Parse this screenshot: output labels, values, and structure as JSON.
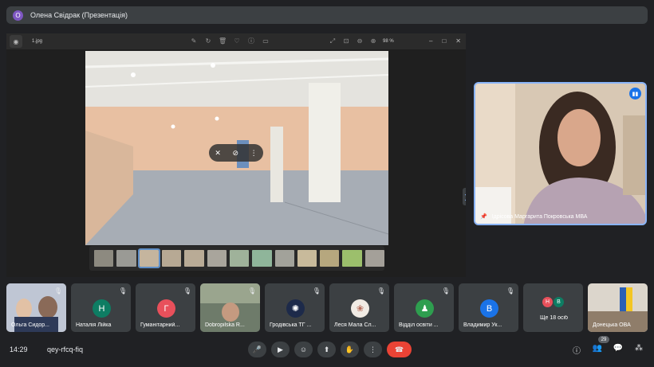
{
  "presenter_bar": {
    "avatar_letter": "О",
    "title": "Олена Свідрак (Презентація)"
  },
  "viewer": {
    "app_icon": "image-viewer-icon",
    "file_name": "1.jpg",
    "zoom": "98 %",
    "tools": [
      "edit-icon",
      "rotate-icon",
      "delete-icon",
      "favorite-icon",
      "info-icon",
      "share-icon"
    ],
    "view_tools": [
      "fullscreen-icon",
      "fit-icon",
      "zoom-out-icon",
      "zoom-in-icon"
    ],
    "window": {
      "minimize": "‒",
      "maximize": "□",
      "close": "✕"
    }
  },
  "speaker": {
    "name": "Ідрісова Маргарита Покровська МВА",
    "badge_icon": "speaking-indicator-icon"
  },
  "participants": [
    {
      "name": "Ольга Сидор...",
      "avatar": "",
      "color": ""
    },
    {
      "name": "Наталія Лійка",
      "avatar": "Н",
      "color": "#0e7d63"
    },
    {
      "name": "Гуманітарний...",
      "avatar": "Г",
      "color": "#e8505b"
    },
    {
      "name": "Dobropilska R...",
      "avatar": "",
      "color": ""
    },
    {
      "name": "Гродівська ТГ ...",
      "avatar": "",
      "color": ""
    },
    {
      "name": "Леся Мала Сл...",
      "avatar": "",
      "color": ""
    },
    {
      "name": "Відділ освіти ...",
      "avatar": "",
      "color": ""
    },
    {
      "name": "Владимир Ук...",
      "avatar": "В",
      "color": "#1a73e8"
    },
    {
      "name": "Ще 18 осіб",
      "avatar": "",
      "color": ""
    },
    {
      "name": "Донецька ОВА",
      "avatar": "",
      "color": ""
    }
  ],
  "more_avatars": [
    "Н",
    "В"
  ],
  "bottom": {
    "time": "14:29",
    "meeting_code": "qey-rfcq-fiq",
    "participant_count": "29"
  },
  "colors": {
    "accent": "#8ab4f8",
    "end_call": "#ea4335",
    "bg": "#202124",
    "tile": "#3c4043"
  }
}
